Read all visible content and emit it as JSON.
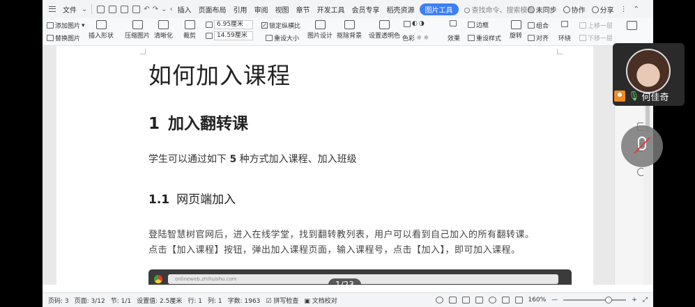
{
  "menubar": {
    "file_label": "文件",
    "items": [
      "插入",
      "页面布局",
      "引用",
      "审阅",
      "视图",
      "章节",
      "开发工具",
      "会员专享",
      "稻壳资源"
    ],
    "active_tab": "图片工具",
    "search_placeholder": "查找命令、搜索模板",
    "sync_label": "未同步",
    "collab_label": "协作",
    "share_label": "分享"
  },
  "ribbon": {
    "add_image": "添加图片",
    "replace_image": "替换图片",
    "insert_shape": "插入形状",
    "compress_image": "压缩图片",
    "sharpen": "清晰化",
    "crop": "裁剪",
    "width_value": "6.95厘米",
    "height_value": "14.59厘米",
    "lock_ratio": "锁定纵横比",
    "reset_size": "重设大小",
    "image_design": "图片设计",
    "remove_bg": "抠除背景",
    "set_transparent": "设置透明色",
    "color": "色彩",
    "effect": "效果",
    "border": "边框",
    "reset_style": "重设样式",
    "rotate": "旋转",
    "group": "组合",
    "align": "对齐",
    "wrap": "环绕",
    "bring_forward": "上移一层",
    "send_backward": "下移一层"
  },
  "document": {
    "title": "如何加入课程",
    "h1_num": "1",
    "h1_text": "加入翻转课",
    "para1_pre": "学生可以通过如下",
    "para1_num": "5",
    "para1_post": "种方式加入课程、加入班级",
    "h2_num": "1.1",
    "h2_text": "网页端加入",
    "para2_line1": "登陆智慧树官网后，进入在线学堂，找到翻转教列表，用户可以看到自己加入的所有翻转课。",
    "para2_line2": "点击【加入课程】按钮，弹出加入课程页面，输入课程号，点击【加入】，即可加入课程。",
    "embedded_url": "onlineweb.zhihuishu.com"
  },
  "page_indicator": "1/23",
  "status": {
    "page_code": "页码: 3",
    "pages": "页面: 3/12",
    "section": "节: 1/1",
    "setting": "设置值: 2.5厘米",
    "row": "行: 1",
    "col": "列: 1",
    "words": "字数: 1963",
    "spell": "拼写检查",
    "proofread": "文档校对",
    "zoom": "160%"
  },
  "video": {
    "participant_name": "何佳奇"
  }
}
